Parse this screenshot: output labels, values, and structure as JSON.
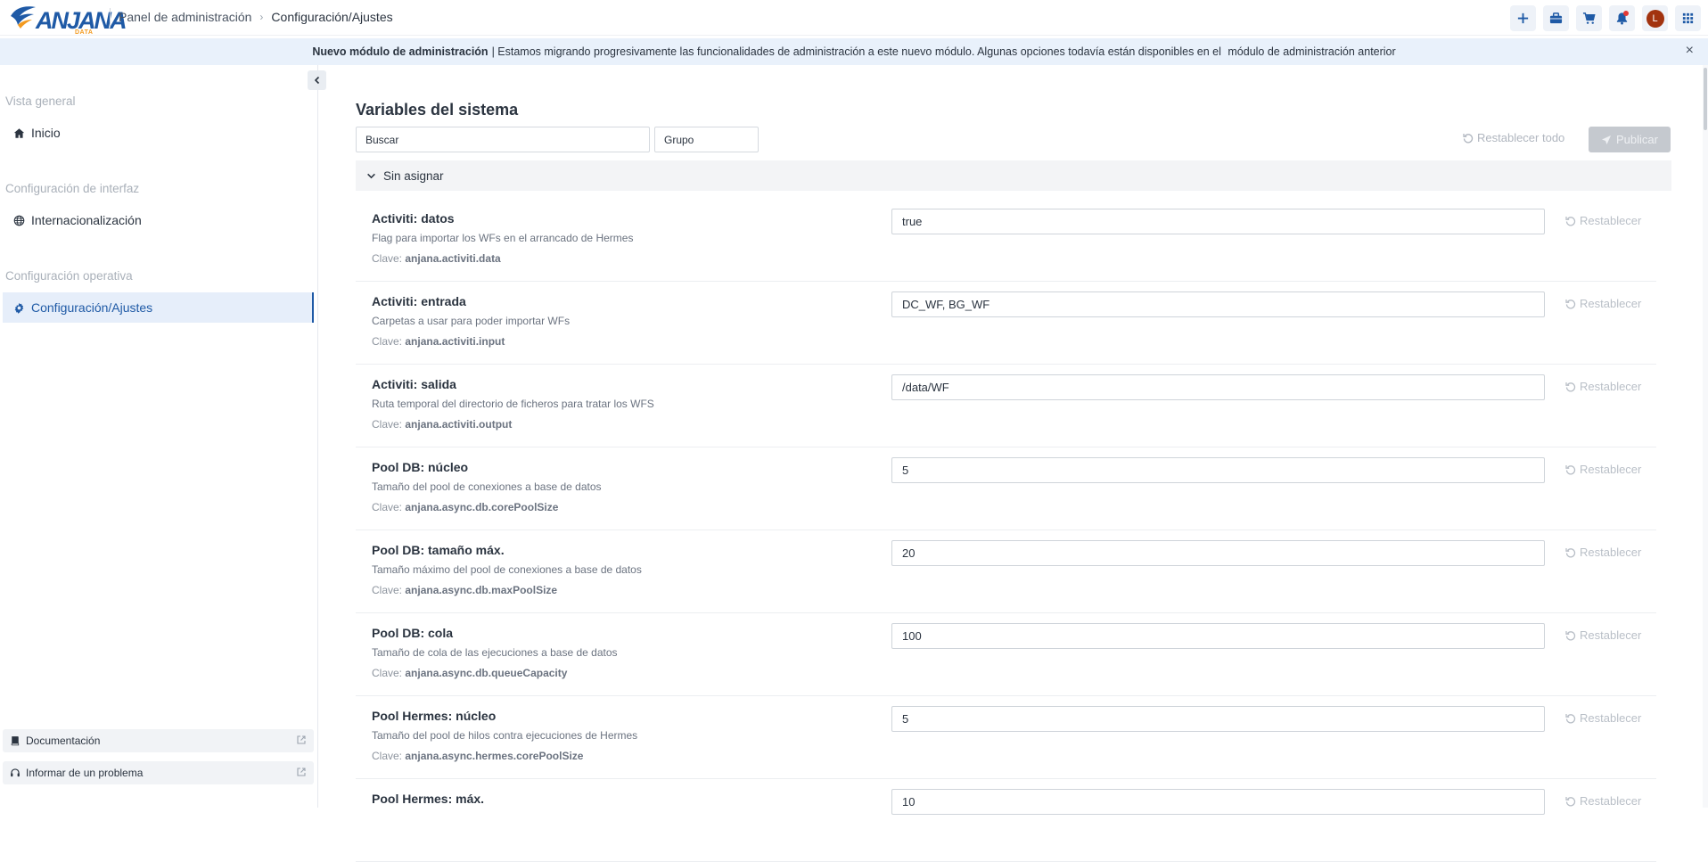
{
  "header": {
    "logo_text": "ANJANA",
    "logo_sub": "DATA",
    "breadcrumb": [
      "Panel de administración",
      "Configuración/Ajustes"
    ],
    "avatar_initial": "L"
  },
  "banner": {
    "bold": "Nuevo módulo de administración",
    "text": "| Estamos migrando progresivamente las funcionalidades de administración a este nuevo módulo. Algunas opciones todavía están disponibles en el ",
    "link": "módulo de administración anterior",
    "close": "×"
  },
  "sidebar": {
    "sections": [
      {
        "title": "Vista general",
        "items": [
          {
            "label": "Inicio",
            "icon": "home-icon"
          }
        ]
      },
      {
        "title": "Configuración de interfaz",
        "items": [
          {
            "label": "Internacionalización",
            "icon": "globe-icon"
          }
        ]
      },
      {
        "title": "Configuración operativa",
        "items": [
          {
            "label": "Configuración/Ajustes",
            "icon": "gear-icon",
            "active": true
          }
        ]
      }
    ],
    "footer_links": [
      {
        "label": "Documentación",
        "icon": "book-icon"
      },
      {
        "label": "Informar de un problema",
        "icon": "headset-icon"
      }
    ]
  },
  "main": {
    "title": "Variables del sistema",
    "search_placeholder": "Buscar",
    "group_placeholder": "Grupo",
    "reset_all_label": "Restablecer todo",
    "publish_label": "Publicar",
    "group_label": "Sin asignar",
    "key_prefix": "Clave: ",
    "reset_label": "Restablecer",
    "settings": [
      {
        "title": "Activiti: datos",
        "desc": "Flag para importar los WFs en el arrancado de Hermes",
        "key": "anjana.activiti.data",
        "value": "true"
      },
      {
        "title": "Activiti: entrada",
        "desc": "Carpetas a usar para poder importar WFs",
        "key": "anjana.activiti.input",
        "value": "DC_WF, BG_WF"
      },
      {
        "title": "Activiti: salida",
        "desc": "Ruta temporal del directorio de ficheros para tratar los WFS",
        "key": "anjana.activiti.output",
        "value": "/data/WF"
      },
      {
        "title": "Pool DB: núcleo",
        "desc": "Tamaño del pool de conexiones a base de datos",
        "key": "anjana.async.db.corePoolSize",
        "value": "5"
      },
      {
        "title": "Pool DB: tamaño máx.",
        "desc": "Tamaño máximo del pool de conexiones a base de datos",
        "key": "anjana.async.db.maxPoolSize",
        "value": "20"
      },
      {
        "title": "Pool DB: cola",
        "desc": "Tamaño de cola de las ejecuciones a base de datos",
        "key": "anjana.async.db.queueCapacity",
        "value": "100"
      },
      {
        "title": "Pool Hermes: núcleo",
        "desc": "Tamaño del pool de hilos contra ejecuciones de Hermes",
        "key": "anjana.async.hermes.corePoolSize",
        "value": "5"
      },
      {
        "title": "Pool Hermes: máx.",
        "desc": "",
        "key": "",
        "value": "10"
      }
    ]
  },
  "colors": {
    "accent": "#1f5aa6",
    "banner_bg": "#e9f1fb",
    "active_bg": "#e6eefa",
    "logo_orange": "#f39a1f"
  }
}
